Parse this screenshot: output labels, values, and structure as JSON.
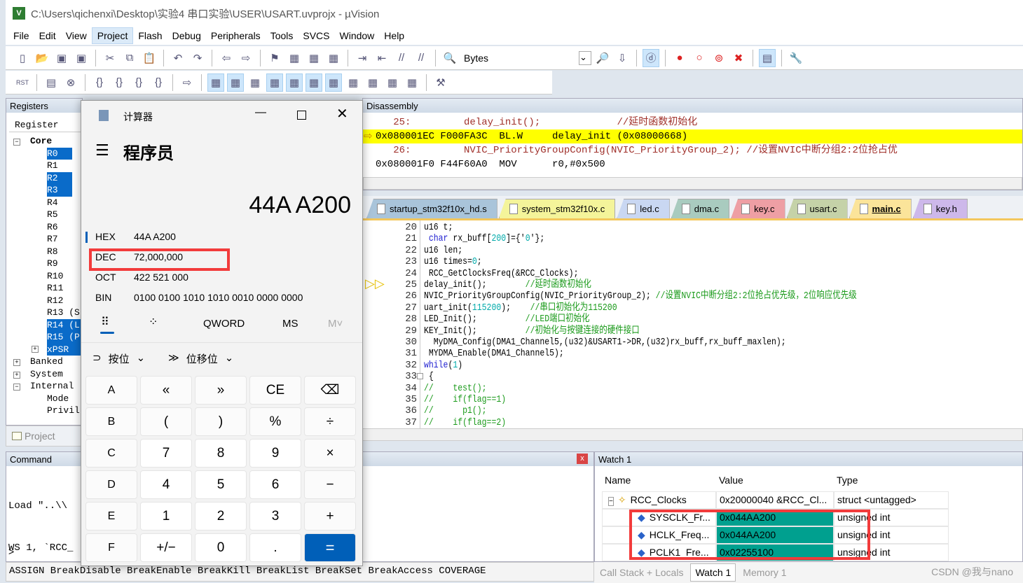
{
  "window": {
    "title": "C:\\Users\\qichenxi\\Desktop\\实验4 串口实验\\USER\\USART.uvprojx - µVision",
    "logo": "V"
  },
  "menu": [
    "File",
    "Edit",
    "View",
    "Project",
    "Flash",
    "Debug",
    "Peripherals",
    "Tools",
    "SVCS",
    "Window",
    "Help"
  ],
  "menu_active": "Project",
  "toolbar1": {
    "icons": [
      "new-file-icon",
      "open-folder-icon",
      "save-icon",
      "save-all-icon",
      "cut-icon",
      "copy-icon",
      "paste-icon",
      "undo-icon",
      "redo-icon",
      "nav-back-icon",
      "nav-forward-icon",
      "bookmark-icon",
      "bookmark-prev-icon",
      "bookmark-next-icon",
      "bookmark-clear-icon",
      "indent-icon",
      "unindent-icon",
      "comment-icon",
      "uncomment-icon",
      "find-in-files-icon"
    ],
    "find_value": "Bytes",
    "right_icons": [
      "find-icon",
      "incremental-find-icon",
      "debug-session-icon",
      "breakpoint-icon",
      "disable-breakpoint-icon",
      "disable-all-breakpoints-icon",
      "kill-breakpoints-icon",
      "window-layout-icon",
      "configure-icon"
    ]
  },
  "toolbar2": {
    "icons": [
      "reset-icon",
      "run-icon",
      "stop-icon",
      "step-into-icon",
      "step-over-icon",
      "step-out-icon",
      "run-to-cursor-icon",
      "show-next-statement-icon",
      "command-window-icon",
      "disassembly-window-icon",
      "symbols-window-icon",
      "registers-window-icon",
      "call-stack-icon",
      "watch-window-icon",
      "memory-window-icon",
      "serial-window-icon",
      "analysis-window-icon",
      "trace-window-icon",
      "system-viewer-icon",
      "toolbox-icon"
    ]
  },
  "registers": {
    "title": "Registers",
    "column": "Register",
    "tree": [
      {
        "label": "Core",
        "level": 0,
        "toggle": "−",
        "bold": true
      },
      {
        "label": "R0",
        "level": 1,
        "sel": true
      },
      {
        "label": "R1",
        "level": 1
      },
      {
        "label": "R2",
        "level": 1,
        "sel": true
      },
      {
        "label": "R3",
        "level": 1,
        "sel": true
      },
      {
        "label": "R4",
        "level": 1
      },
      {
        "label": "R5",
        "level": 1
      },
      {
        "label": "R6",
        "level": 1
      },
      {
        "label": "R7",
        "level": 1
      },
      {
        "label": "R8",
        "level": 1
      },
      {
        "label": "R9",
        "level": 1
      },
      {
        "label": "R10",
        "level": 1
      },
      {
        "label": "R11",
        "level": 1
      },
      {
        "label": "R12",
        "level": 1
      },
      {
        "label": "R13 (S",
        "level": 1
      },
      {
        "label": "R14 (L",
        "level": 1,
        "sel": true
      },
      {
        "label": "R15 (P",
        "level": 1,
        "sel": true
      },
      {
        "label": "xPSR",
        "level": 1,
        "sel": true,
        "toggle": "+"
      },
      {
        "label": "Banked",
        "level": 0,
        "toggle": "+"
      },
      {
        "label": "System",
        "level": 0,
        "toggle": "+"
      },
      {
        "label": "Internal",
        "level": 0,
        "toggle": "−"
      },
      {
        "label": "Mode",
        "level": 1
      },
      {
        "label": "Privil",
        "level": 1
      }
    ],
    "project_tab": "Project"
  },
  "command": {
    "title": "Command",
    "lines": [
      "Load \"..\\\\",
      "WS 1, `RCC_"
    ],
    "prompt": ">",
    "hint": "ASSIGN BreakDisable BreakEnable BreakKill BreakList BreakSet BreakAccess COVERAGE"
  },
  "calculator": {
    "title": "计算器",
    "mode": "程序员",
    "display": "44A A200",
    "radix": [
      {
        "k": "HEX",
        "v": "44A A200"
      },
      {
        "k": "DEC",
        "v": "72,000,000"
      },
      {
        "k": "OCT",
        "v": "422 521 000"
      },
      {
        "k": "BIN",
        "v": "0100 0100 1010 1010 0010 0000 0000"
      }
    ],
    "word": "QWORD",
    "ms": "MS",
    "mv": "M˅",
    "bitwise": "按位",
    "bitshift": "位移位",
    "buttons": [
      [
        "A",
        "«",
        "»",
        "CE",
        "⌫"
      ],
      [
        "B",
        "(",
        ")",
        "%",
        "÷"
      ],
      [
        "C",
        "7",
        "8",
        "9",
        "×"
      ],
      [
        "D",
        "4",
        "5",
        "6",
        "−"
      ],
      [
        "E",
        "1",
        "2",
        "3",
        "+"
      ],
      [
        "F",
        "+/−",
        "0",
        ".",
        "="
      ]
    ]
  },
  "disassembly": {
    "title": "Disassembly",
    "lines": [
      {
        "t": "   25:         delay_init();             //延时函数初始化",
        "src": true
      },
      {
        "t": "0x080001EC F000FA3C  BL.W     delay_init (0x08000668)",
        "cur": true
      },
      {
        "t": "   26:         NVIC_PriorityGroupConfig(NVIC_PriorityGroup_2); //设置NVIC中断分组2:2位抢占优",
        "src": true
      },
      {
        "t": "0x080001F0 F44F60A0  MOV      r0,#0x500"
      }
    ]
  },
  "file_tabs": [
    {
      "label": "startup_stm32f10x_hd.s",
      "color": "#a9c4da"
    },
    {
      "label": "system_stm32f10x.c",
      "color": "#f4f49a"
    },
    {
      "label": "led.c",
      "color": "#c9d7f2"
    },
    {
      "label": "dma.c",
      "color": "#a9cbbf"
    },
    {
      "label": "key.c",
      "color": "#ee9fa4"
    },
    {
      "label": "usart.c",
      "color": "#c5d2a8"
    },
    {
      "label": "main.c",
      "color": "#fbe49a",
      "active": true
    },
    {
      "label": "key.h",
      "color": "#cdb8ea"
    }
  ],
  "code": [
    {
      "n": "20",
      "s": [
        [
          "u16 t;",
          ""
        ]
      ]
    },
    {
      "n": "21",
      "s": [
        [
          " char",
          "kw"
        ],
        [
          " rx_buff[",
          ""
        ],
        [
          "200",
          "nm"
        ],
        [
          "]={'",
          ""
        ],
        [
          "0",
          "st"
        ],
        [
          "'};",
          ""
        ]
      ]
    },
    {
      "n": "22",
      "s": [
        [
          "u16 len;",
          ""
        ]
      ]
    },
    {
      "n": "23",
      "s": [
        [
          "u16 times=",
          ""
        ],
        [
          "0",
          "nm"
        ],
        [
          ";",
          ""
        ]
      ]
    },
    {
      "n": "24",
      "s": [
        [
          " RCC_GetClocksFreq(&RCC_Clocks);",
          ""
        ]
      ]
    },
    {
      "n": "25",
      "s": [
        [
          "delay_init();        ",
          ""
        ],
        [
          "//延时函数初始化",
          "cm"
        ]
      ]
    },
    {
      "n": "26",
      "s": [
        [
          "NVIC_PriorityGroupConfig(NVIC_PriorityGroup_2); ",
          ""
        ],
        [
          "//设置NVIC中断分组2:2位抢占优先级，2位响应优先级",
          "cm"
        ]
      ]
    },
    {
      "n": "27",
      "s": [
        [
          "uart_init(",
          ""
        ],
        [
          "115200",
          "nm"
        ],
        [
          ");    ",
          ""
        ],
        [
          "//串口初始化为115200",
          "cm"
        ]
      ]
    },
    {
      "n": "28",
      "s": [
        [
          "LED_Init();          ",
          ""
        ],
        [
          "//LED端口初始化",
          "cm"
        ]
      ]
    },
    {
      "n": "29",
      "s": [
        [
          "KEY_Init();          ",
          ""
        ],
        [
          "//初始化与按键连接的硬件接口",
          "cm"
        ]
      ]
    },
    {
      "n": "30",
      "s": [
        [
          "  MyDMA_Config(DMA1_Channel5,(u32)&USART1->DR,(u32)rx_buff,rx_buff_maxlen);",
          ""
        ]
      ]
    },
    {
      "n": "31",
      "s": [
        [
          " MYDMA_Enable(DMA1_Channel5);",
          ""
        ]
      ]
    },
    {
      "n": "32",
      "s": [
        [
          "while",
          "kw"
        ],
        [
          "(",
          ""
        ],
        [
          "1",
          "nm"
        ],
        [
          ")",
          ""
        ]
      ]
    },
    {
      "n": "33",
      "s": [
        [
          " {",
          ""
        ]
      ]
    },
    {
      "n": "34",
      "s": [
        [
          "//    test();",
          "cm"
        ]
      ]
    },
    {
      "n": "35",
      "s": [
        [
          "//    if(flag==1)",
          "cm"
        ]
      ]
    },
    {
      "n": "36",
      "s": [
        [
          "//      p1();",
          "cm"
        ]
      ]
    },
    {
      "n": "37",
      "s": [
        [
          "//    if(flag==2)",
          "cm"
        ]
      ]
    }
  ],
  "watch": {
    "title": "Watch 1",
    "columns": [
      "Name",
      "Value",
      "Type"
    ],
    "rows": [
      {
        "name": "RCC_Clocks",
        "value": "0x20000040 &RCC_Cl...",
        "type": "struct <untagged>",
        "root": true
      },
      {
        "name": "SYSCLK_Fr...",
        "value": "0x044AA200",
        "type": "unsigned int",
        "hl": true
      },
      {
        "name": "HCLK_Freq...",
        "value": "0x044AA200",
        "type": "unsigned int",
        "hl": true
      },
      {
        "name": "PCLK1_Fre...",
        "value": "0x02255100",
        "type": "unsigned int",
        "hl": true
      }
    ],
    "tabs": [
      "Call Stack + Locals",
      "Watch 1",
      "Memory 1"
    ],
    "active_tab": "Watch 1"
  },
  "watermark": "CSDN @我与nano",
  "colors": {
    "highlight_value": "#00a08f",
    "annotation_box": "#f23b3b",
    "current_line": "#ffff00",
    "calc_accent": "#005fb8"
  }
}
